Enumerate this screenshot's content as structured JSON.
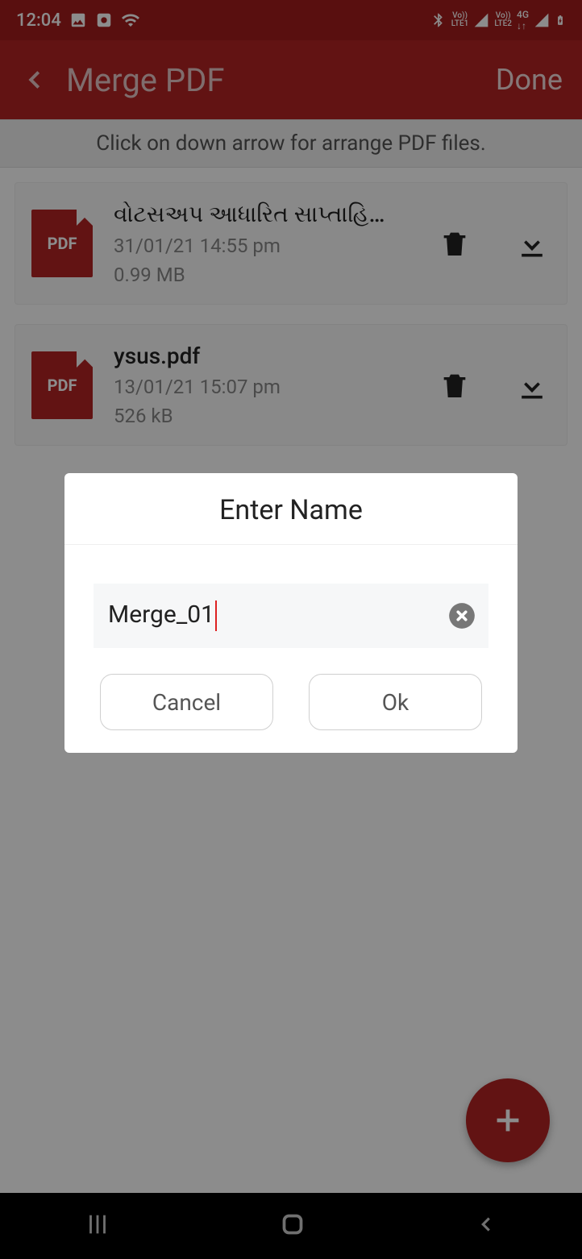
{
  "status": {
    "time": "12:04",
    "lte1": "Vo))\nLTE1",
    "lte2": "Vo))\nLTE2",
    "net": "4G"
  },
  "appbar": {
    "title": "Merge PDF",
    "done": "Done"
  },
  "hint": "Click on down arrow for arrange PDF files.",
  "files": [
    {
      "name": "વોટસઅપ આધારિત સાપ્તાહિ…",
      "date": "31/01/21 14:55 pm",
      "size": "0.99 MB"
    },
    {
      "name": "ysus.pdf",
      "date": "13/01/21 15:07 pm",
      "size": "526 kB"
    }
  ],
  "pdf_label": "PDF",
  "dialog": {
    "title": "Enter Name",
    "value": "Merge_01",
    "cancel": "Cancel",
    "ok": "Ok"
  }
}
